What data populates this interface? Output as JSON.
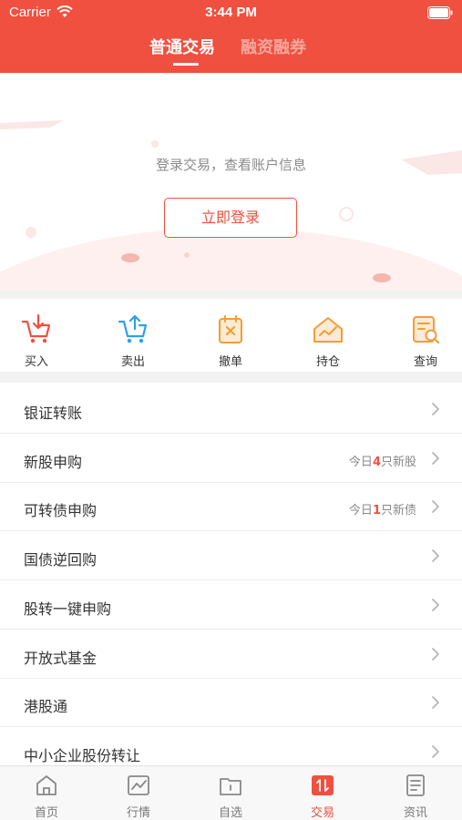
{
  "status_bar": {
    "carrier": "Carrier",
    "time": "3:44 PM"
  },
  "header": {
    "tabs": [
      {
        "label": "普通交易",
        "active": true
      },
      {
        "label": "融资融券",
        "active": false
      }
    ]
  },
  "login": {
    "prompt": "登录交易，查看账户信息",
    "button_label": "立即登录"
  },
  "quick_actions": [
    {
      "label": "买入",
      "icon": "cart-down-icon"
    },
    {
      "label": "卖出",
      "icon": "cart-up-icon"
    },
    {
      "label": "撤单",
      "icon": "cancel-order-icon"
    },
    {
      "label": "持仓",
      "icon": "holdings-icon"
    },
    {
      "label": "查询",
      "icon": "query-icon"
    }
  ],
  "menu": [
    {
      "label": "银证转账"
    },
    {
      "label": "新股申购",
      "badge_prefix": "今日",
      "badge_count": "4",
      "badge_suffix": "只新股"
    },
    {
      "label": "可转债申购",
      "badge_prefix": "今日",
      "badge_count": "1",
      "badge_suffix": "只新债"
    },
    {
      "label": "国债逆回购"
    },
    {
      "label": "股转一键申购"
    },
    {
      "label": "开放式基金"
    },
    {
      "label": "港股通"
    },
    {
      "label": "中小企业股份转让"
    }
  ],
  "tabbar": [
    {
      "label": "首页",
      "icon": "home-icon",
      "active": false
    },
    {
      "label": "行情",
      "icon": "market-chart-icon",
      "active": false
    },
    {
      "label": "自选",
      "icon": "watchlist-folder-icon",
      "active": false
    },
    {
      "label": "交易",
      "icon": "trade-icon",
      "active": true
    },
    {
      "label": "资讯",
      "icon": "news-icon",
      "active": false
    }
  ],
  "colors": {
    "brand": "#f0503f",
    "orange_icon": "#f29d38",
    "blue_icon": "#2ea0e6"
  }
}
